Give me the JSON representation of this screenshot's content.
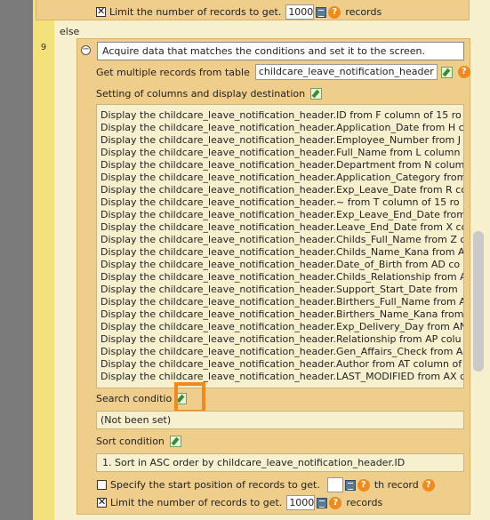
{
  "line_number": "9",
  "else_label": "else",
  "top_limit": {
    "label_before": "Limit the number of records to get.",
    "value": "1000",
    "label_after": "records",
    "checked": true
  },
  "block": {
    "title_value": "Acquire data that matches the conditions and set it to the screen.",
    "get_records_label": "Get multiple records from table",
    "table_name": "childcare_leave_notification_header",
    "columns_label": "Setting of columns and display destination",
    "columns": [
      "Display the childcare_leave_notification_header.ID from F column of 15 ro",
      "Display the childcare_leave_notification_header.Application_Date from H c",
      "Display the childcare_leave_notification_header.Employee_Number from J",
      "Display the childcare_leave_notification_header.Full_Name from L column",
      "Display the childcare_leave_notification_header.Department from N colum",
      "Display the childcare_leave_notification_header.Application_Category from",
      "Display the childcare_leave_notification_header.Exp_Leave_Date from R co",
      "Display the childcare_leave_notification_header.~ from T column of 15 ro",
      "Display the childcare_leave_notification_header.Exp_Leave_End_Date from",
      "Display the childcare_leave_notification_header.Leave_End_Date from X co",
      "Display the childcare_leave_notification_header.Childs_Full_Name from Z c",
      "Display the childcare_leave_notification_header.Childs_Name_Kana from A",
      "Display the childcare_leave_notification_header.Date_of_Birth from AD co",
      "Display the childcare_leave_notification_header.Childs_Relationship from A",
      "Display the childcare_leave_notification_header.Support_Start_Date from",
      "Display the childcare_leave_notification_header.Birthers_Full_Name from A",
      "Display the childcare_leave_notification_header.Birthers_Name_Kana from",
      "Display the childcare_leave_notification_header.Exp_Delivery_Day from AN",
      "Display the childcare_leave_notification_header.Relationship from AP colu",
      "Display the childcare_leave_notification_header.Gen_Affairs_Check from A",
      "Display the childcare_leave_notification_header.Author from AT column of",
      "Display the childcare_leave_notification_header.LAST_MODIFIED from AX c"
    ],
    "search_label": "Search conditio",
    "search_value": "(Not been set)",
    "sort_label": "Sort condition",
    "sort_value": "1. Sort in ASC order by childcare_leave_notification_header.ID",
    "start_pos": {
      "label": "Specify the start position of records to get.",
      "value": "",
      "suffix": "th record",
      "checked": false
    },
    "limit": {
      "label_before": "Limit the number of records to get.",
      "value": "1000",
      "label_after": "records",
      "checked": true
    }
  },
  "icons": {
    "help": "help-icon",
    "edit": "edit-icon",
    "calc": "calculator-icon",
    "collapse": "collapse-icon"
  },
  "colors": {
    "block_bg": "#efcd8a",
    "gutter": "#7b7b7b",
    "line_col": "#f3e27a",
    "highlight": "#f08a1c"
  }
}
